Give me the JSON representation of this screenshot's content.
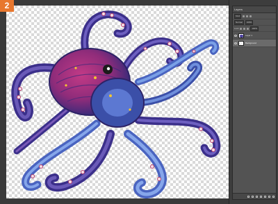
{
  "step_badge": "2",
  "layers_panel": {
    "tab_label": "Layers",
    "kind_filter": "Kind",
    "blend_mode": "Normal",
    "opacity": "100%",
    "lock_label": "Lock",
    "fill": "100%",
    "layers": [
      {
        "name": "Layer 1",
        "selected": false,
        "visible": true
      },
      {
        "name": "Background",
        "selected": true,
        "visible": true
      }
    ],
    "footer_icons": [
      "link-icon",
      "fx-icon",
      "mask-icon",
      "adjustment-icon",
      "group-icon",
      "new-layer-icon",
      "trash-icon"
    ]
  },
  "colors": {
    "accent_badge": "#e8772e",
    "panel_bg": "#535353",
    "app_bg": "#3a3a3a"
  }
}
